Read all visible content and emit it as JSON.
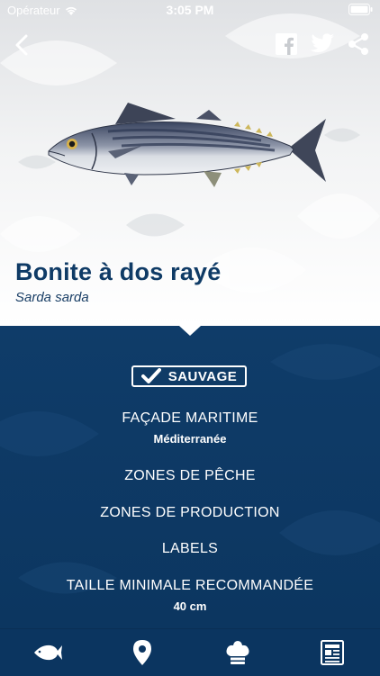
{
  "status_bar": {
    "carrier": "Opérateur",
    "time": "3:05 PM"
  },
  "nav": {
    "back_icon": "chevron-left-icon",
    "share_icons": [
      "facebook-icon",
      "twitter-icon",
      "share-icon"
    ]
  },
  "species": {
    "common_name": "Bonite à dos rayé",
    "scientific_name": "Sarda sarda"
  },
  "badge": {
    "label": "SAUVAGE",
    "icon": "check-icon"
  },
  "info": {
    "facade_label": "FAÇADE MARITIME",
    "facade_value": "Méditerranée",
    "fishing_zones_label": "ZONES DE PÊCHE",
    "production_zones_label": "ZONES DE PRODUCTION",
    "labels_label": "LABELS",
    "min_size_label": "TAILLE MINIMALE RECOMMANDÉE",
    "min_size_value": "40 cm"
  },
  "tabs": [
    {
      "icon": "fish-icon"
    },
    {
      "icon": "map-pin-icon"
    },
    {
      "icon": "chef-hat-icon"
    },
    {
      "icon": "newspaper-icon"
    }
  ],
  "colors": {
    "navy": "#0f3b66",
    "panel": "#0d3a66",
    "white": "#ffffff"
  }
}
